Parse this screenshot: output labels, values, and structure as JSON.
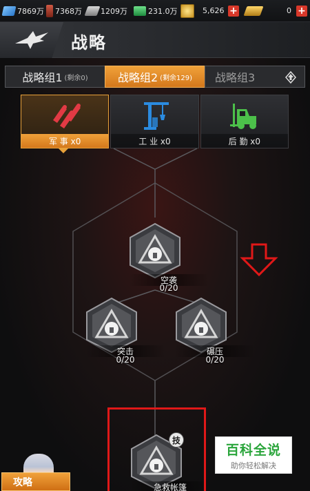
{
  "resources": [
    {
      "icon": "crystal-icon",
      "value": "7869万"
    },
    {
      "icon": "oil-icon",
      "value": "7368万"
    },
    {
      "icon": "steel-icon",
      "value": "1209万"
    },
    {
      "icon": "cash-icon",
      "value": "231.0万"
    },
    {
      "icon": "coin-icon",
      "value": "5,626"
    },
    {
      "icon": "gold-bar-icon",
      "value": "0"
    }
  ],
  "header": {
    "title": "战略"
  },
  "tabs": [
    {
      "label": "战略组1",
      "sub": "(剩余0)",
      "active": false
    },
    {
      "label": "战略组2",
      "sub": "(剩余129)",
      "active": true
    },
    {
      "label": "战略组3",
      "sub": "",
      "active": false
    }
  ],
  "categories": [
    {
      "label": "军 事 x0",
      "icon": "missiles-icon",
      "active": true
    },
    {
      "label": "工 业 x0",
      "icon": "crane-icon",
      "active": false
    },
    {
      "label": "后 勤 x0",
      "icon": "forklift-icon",
      "active": false
    }
  ],
  "tree": {
    "nodes": [
      {
        "name": "空袭",
        "count": "0/20"
      },
      {
        "name": "突击",
        "count": "0/20"
      },
      {
        "name": "碾压",
        "count": "0/20"
      },
      {
        "name": "急救帐篷",
        "count": "",
        "badge": "技"
      }
    ]
  },
  "guide": {
    "label": "攻略"
  },
  "watermark": {
    "main": "百科全说",
    "sub": "助你轻松解决"
  },
  "colors": {
    "accent": "#e8982c",
    "highlight": "#e01818"
  }
}
